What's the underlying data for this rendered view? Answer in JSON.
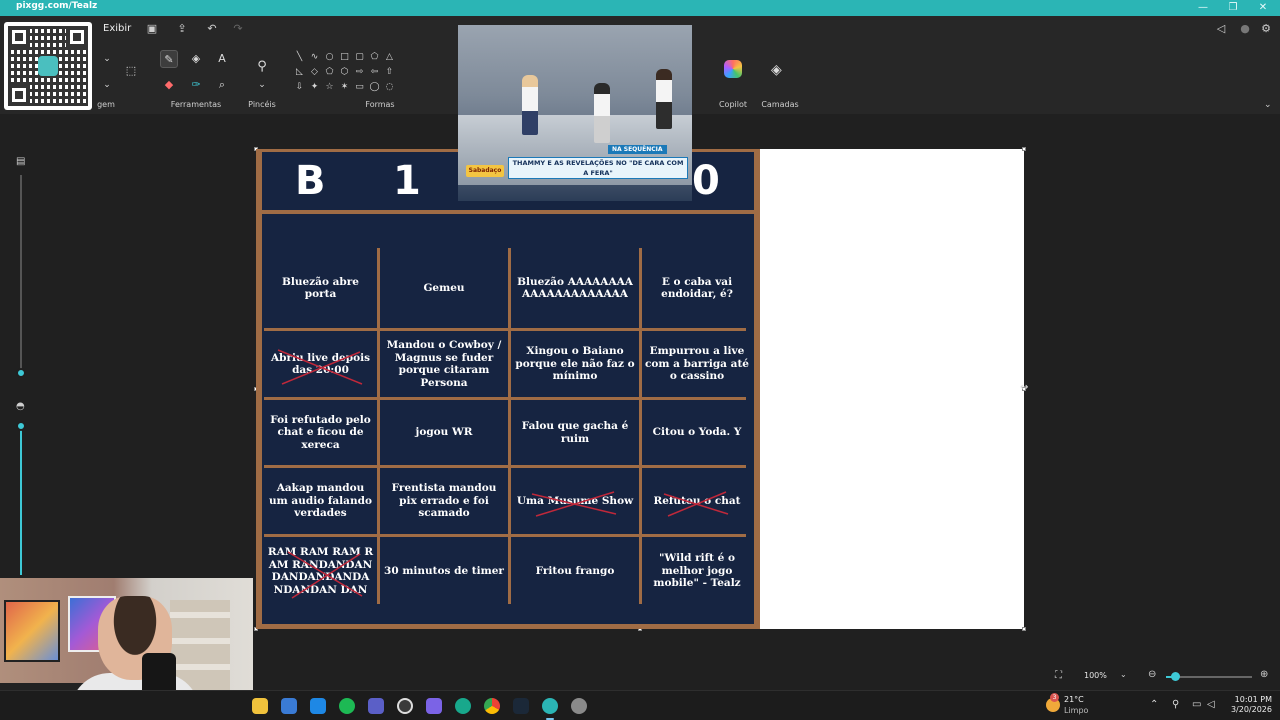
{
  "titlebar": {
    "url": "pixgg.com/Tealz",
    "minimize": "—",
    "maximize": "❐",
    "close": "✕"
  },
  "ribbon": {
    "menu_exibir": "Exibir",
    "cut_label": "gem",
    "groups": {
      "ferramentas": "Ferramentas",
      "pinceis": "Pincéis",
      "formas": "Formas",
      "copilot": "Copilot",
      "camadas": "Camadas"
    }
  },
  "bingo": {
    "header_letters": [
      "B",
      "1",
      "0"
    ],
    "cells": [
      "Bluezão abre porta",
      "Gemeu",
      "Bluezão AAAAAAAAAAAAAAAAAAAAA",
      "E o caba vai endoidar, é?",
      "Abriu live depois das 20:00",
      "Mandou o Cowboy / Magnus se fuder porque citaram Persona",
      "Xingou o Baiano porque ele não faz o mínimo",
      "Empurrou a live com a barriga até o cassino",
      "Foi refutado pelo chat e ficou de xereca",
      "jogou WR",
      "Falou que gacha é ruim",
      "Citou o Yoda. Y",
      "Aakap mandou um audio falando verdades",
      "Frentista mandou pix errado e foi scamado",
      "Uma Musume Show",
      "Refutou o chat",
      "RAM RAM RAM RAM RANDANDANDANDANDANDANDANDAN DAN",
      "30 minutos de timer",
      "Fritou frango",
      "\"Wild rift é o melhor jogo mobile\" - Tealz"
    ]
  },
  "video": {
    "badge": "NA SEQUÊNCIA",
    "ticker": "THAMMY E AS REVELAÇÕES NO \"DE CARA COM A FERA\"",
    "logo": "Sabadaço"
  },
  "zoom": {
    "value": "100%",
    "dropdown": "⌄",
    "level": 0.1
  },
  "taskbar": {
    "weather_temp": "21°C",
    "weather_desc": "Limpo",
    "weather_badge": "3",
    "time": "10:01 PM",
    "date": "3/20/2026"
  },
  "colors": {
    "accent": "#2bb5b5",
    "board_navy": "#162441",
    "board_border": "#a06c45",
    "slider": "#3ec9d6"
  }
}
